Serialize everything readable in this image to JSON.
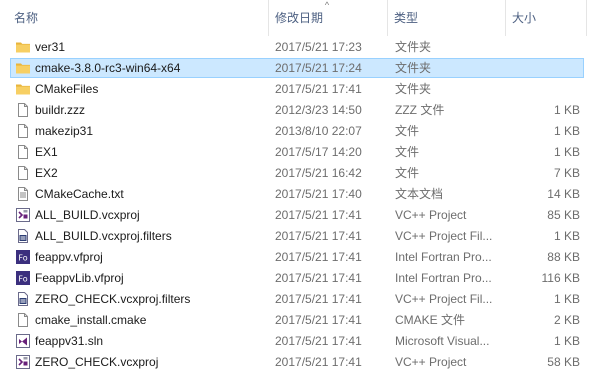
{
  "columns": {
    "name": "名称",
    "date": "修改日期",
    "type": "类型",
    "size": "大小",
    "sort_indicator": "^"
  },
  "colors": {
    "selection_bg": "#cce8ff",
    "selection_border": "#99d1ff",
    "header_text": "#4d6082",
    "folder": "#f7cf63"
  },
  "files": [
    {
      "name": "ver31",
      "date": "2017/5/21 17:23",
      "type": "文件夹",
      "size": "",
      "icon": "folder-icon",
      "selected": false
    },
    {
      "name": "cmake-3.8.0-rc3-win64-x64",
      "date": "2017/5/21 17:24",
      "type": "文件夹",
      "size": "",
      "icon": "folder-icon",
      "selected": true
    },
    {
      "name": "CMakeFiles",
      "date": "2017/5/21 17:41",
      "type": "文件夹",
      "size": "",
      "icon": "folder-icon",
      "selected": false
    },
    {
      "name": "buildr.zzz",
      "date": "2012/3/23 14:50",
      "type": "ZZZ 文件",
      "size": "1 KB",
      "icon": "file-icon",
      "selected": false
    },
    {
      "name": "makezip31",
      "date": "2013/8/10 22:07",
      "type": "文件",
      "size": "1 KB",
      "icon": "file-icon",
      "selected": false
    },
    {
      "name": "EX1",
      "date": "2017/5/17 14:20",
      "type": "文件",
      "size": "1 KB",
      "icon": "file-icon",
      "selected": false
    },
    {
      "name": "EX2",
      "date": "2017/5/21 16:42",
      "type": "文件",
      "size": "7 KB",
      "icon": "file-icon",
      "selected": false
    },
    {
      "name": "CMakeCache.txt",
      "date": "2017/5/21 17:40",
      "type": "文本文档",
      "size": "14 KB",
      "icon": "text-document-icon",
      "selected": false
    },
    {
      "name": "ALL_BUILD.vcxproj",
      "date": "2017/5/21 17:41",
      "type": "VC++ Project",
      "size": "85 KB",
      "icon": "vcxproj-icon",
      "selected": false
    },
    {
      "name": "ALL_BUILD.vcxproj.filters",
      "date": "2017/5/21 17:41",
      "type": "VC++ Project Fil...",
      "size": "1 KB",
      "icon": "vcxproj-filters-icon",
      "selected": false
    },
    {
      "name": "feappv.vfproj",
      "date": "2017/5/21 17:41",
      "type": "Intel Fortran Pro...",
      "size": "88 KB",
      "icon": "fortran-project-icon",
      "selected": false
    },
    {
      "name": "FeappvLib.vfproj",
      "date": "2017/5/21 17:41",
      "type": "Intel Fortran Pro...",
      "size": "116 KB",
      "icon": "fortran-project-icon",
      "selected": false
    },
    {
      "name": "ZERO_CHECK.vcxproj.filters",
      "date": "2017/5/21 17:41",
      "type": "VC++ Project Fil...",
      "size": "1 KB",
      "icon": "vcxproj-filters-icon",
      "selected": false
    },
    {
      "name": "cmake_install.cmake",
      "date": "2017/5/21 17:41",
      "type": "CMAKE 文件",
      "size": "2 KB",
      "icon": "file-icon",
      "selected": false
    },
    {
      "name": "feappv31.sln",
      "date": "2017/5/21 17:41",
      "type": "Microsoft Visual...",
      "size": "1 KB",
      "icon": "solution-icon",
      "selected": false
    },
    {
      "name": "ZERO_CHECK.vcxproj",
      "date": "2017/5/21 17:41",
      "type": "VC++ Project",
      "size": "58 KB",
      "icon": "vcxproj-icon",
      "selected": false
    }
  ]
}
